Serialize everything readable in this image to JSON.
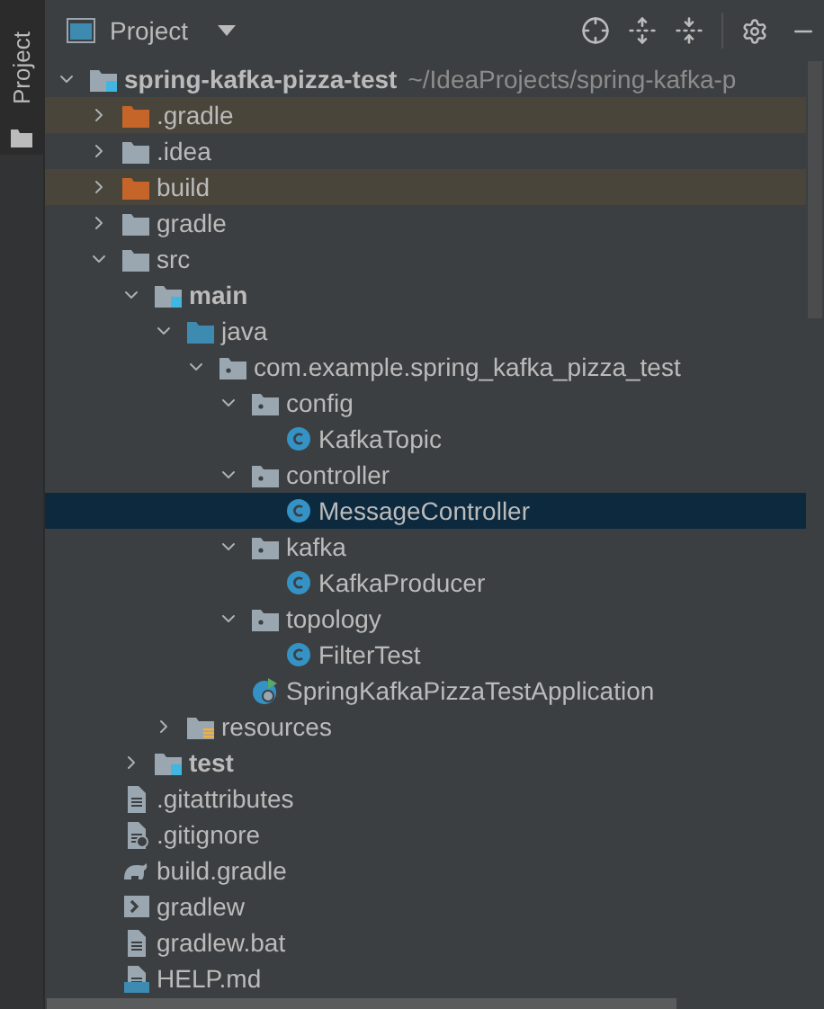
{
  "side_tab": {
    "label": "Project"
  },
  "header": {
    "title": "Project"
  },
  "tree": [
    {
      "label": "spring-kafka-pizza-test",
      "kind": "module",
      "path": "~/IdeaProjects/spring-kafka-p",
      "expanded": true,
      "selected": false,
      "children": [
        {
          "label": ".gradle",
          "kind": "excluded",
          "expanded": false,
          "selected": false
        },
        {
          "label": ".idea",
          "kind": "folder",
          "expanded": false,
          "selected": false
        },
        {
          "label": "build",
          "kind": "excluded",
          "expanded": false,
          "selected": false
        },
        {
          "label": "gradle",
          "kind": "folder",
          "expanded": false,
          "selected": false
        },
        {
          "label": "src",
          "kind": "folder",
          "expanded": true,
          "selected": false,
          "children": [
            {
              "label": "main",
              "kind": "module",
              "expanded": true,
              "selected": false,
              "children": [
                {
                  "label": "java",
                  "kind": "source",
                  "expanded": true,
                  "selected": false,
                  "children": [
                    {
                      "label": "com.example.spring_kafka_pizza_test",
                      "kind": "package",
                      "expanded": true,
                      "selected": false,
                      "children": [
                        {
                          "label": "config",
                          "kind": "package",
                          "expanded": true,
                          "selected": false,
                          "children": [
                            {
                              "label": "KafkaTopic",
                              "kind": "class",
                              "selected": false
                            }
                          ]
                        },
                        {
                          "label": "controller",
                          "kind": "package",
                          "expanded": true,
                          "selected": false,
                          "children": [
                            {
                              "label": "MessageController",
                              "kind": "class",
                              "selected": true
                            }
                          ]
                        },
                        {
                          "label": "kafka",
                          "kind": "package",
                          "expanded": true,
                          "selected": false,
                          "children": [
                            {
                              "label": "KafkaProducer",
                              "kind": "class",
                              "selected": false
                            }
                          ]
                        },
                        {
                          "label": "topology",
                          "kind": "package",
                          "expanded": true,
                          "selected": false,
                          "children": [
                            {
                              "label": "FilterTest",
                              "kind": "class",
                              "selected": false
                            }
                          ]
                        },
                        {
                          "label": "SpringKafkaPizzaTestApplication",
                          "kind": "app",
                          "selected": false
                        }
                      ]
                    }
                  ]
                },
                {
                  "label": "resources",
                  "kind": "resources",
                  "expanded": false,
                  "selected": false
                }
              ]
            },
            {
              "label": "test",
              "kind": "module",
              "expanded": false,
              "selected": false
            }
          ]
        },
        {
          "label": ".gitattributes",
          "kind": "text",
          "selected": false
        },
        {
          "label": ".gitignore",
          "kind": "ignore",
          "selected": false
        },
        {
          "label": "build.gradle",
          "kind": "gradle",
          "selected": false
        },
        {
          "label": "gradlew",
          "kind": "script",
          "selected": false
        },
        {
          "label": "gradlew.bat",
          "kind": "text",
          "selected": false
        },
        {
          "label": "HELP.md",
          "kind": "markdown",
          "selected": false
        }
      ]
    }
  ]
}
